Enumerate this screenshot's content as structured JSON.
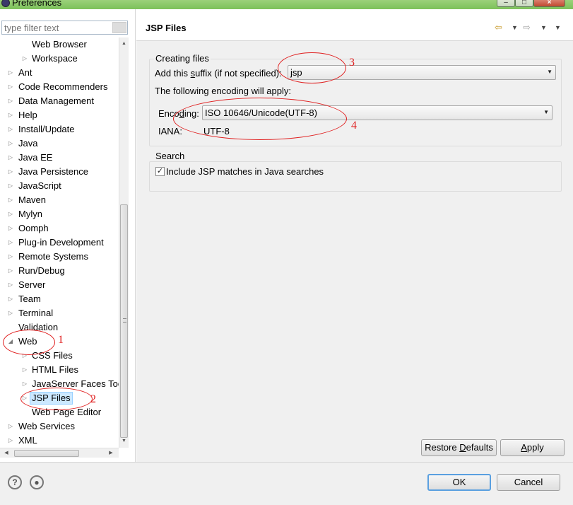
{
  "window": {
    "title": "Preferences"
  },
  "filter": {
    "placeholder": "type filter text"
  },
  "tree": {
    "items": [
      {
        "label": "Web Browser",
        "depth": 2,
        "toggle": "none"
      },
      {
        "label": "Workspace",
        "depth": 2,
        "toggle": "collapsed"
      },
      {
        "label": "Ant",
        "depth": 1,
        "toggle": "collapsed"
      },
      {
        "label": "Code Recommenders",
        "depth": 1,
        "toggle": "collapsed"
      },
      {
        "label": "Data Management",
        "depth": 1,
        "toggle": "collapsed"
      },
      {
        "label": "Help",
        "depth": 1,
        "toggle": "collapsed"
      },
      {
        "label": "Install/Update",
        "depth": 1,
        "toggle": "collapsed"
      },
      {
        "label": "Java",
        "depth": 1,
        "toggle": "collapsed"
      },
      {
        "label": "Java EE",
        "depth": 1,
        "toggle": "collapsed"
      },
      {
        "label": "Java Persistence",
        "depth": 1,
        "toggle": "collapsed"
      },
      {
        "label": "JavaScript",
        "depth": 1,
        "toggle": "collapsed"
      },
      {
        "label": "Maven",
        "depth": 1,
        "toggle": "collapsed"
      },
      {
        "label": "Mylyn",
        "depth": 1,
        "toggle": "collapsed"
      },
      {
        "label": "Oomph",
        "depth": 1,
        "toggle": "collapsed"
      },
      {
        "label": "Plug-in Development",
        "depth": 1,
        "toggle": "collapsed"
      },
      {
        "label": "Remote Systems",
        "depth": 1,
        "toggle": "collapsed"
      },
      {
        "label": "Run/Debug",
        "depth": 1,
        "toggle": "collapsed"
      },
      {
        "label": "Server",
        "depth": 1,
        "toggle": "collapsed"
      },
      {
        "label": "Team",
        "depth": 1,
        "toggle": "collapsed"
      },
      {
        "label": "Terminal",
        "depth": 1,
        "toggle": "collapsed"
      },
      {
        "label": "Validation",
        "depth": 1,
        "toggle": "none"
      },
      {
        "label": "Web",
        "depth": 1,
        "toggle": "expanded"
      },
      {
        "label": "CSS Files",
        "depth": 2,
        "toggle": "collapsed"
      },
      {
        "label": "HTML Files",
        "depth": 2,
        "toggle": "collapsed"
      },
      {
        "label": "JavaServer Faces Too",
        "depth": 2,
        "toggle": "collapsed"
      },
      {
        "label": "JSP Files",
        "depth": 2,
        "toggle": "collapsed",
        "selected": true
      },
      {
        "label": "Web Page Editor",
        "depth": 2,
        "toggle": "none"
      },
      {
        "label": "Web Services",
        "depth": 1,
        "toggle": "collapsed"
      },
      {
        "label": "XML",
        "depth": 1,
        "toggle": "collapsed"
      }
    ]
  },
  "page": {
    "title": "JSP Files",
    "icons": {
      "back": "back-arrow-icon",
      "forward": "forward-arrow-icon",
      "menu": "view-menu-icon"
    },
    "creating": {
      "group_label": "Creating files",
      "suffix_label_pre": "Add this ",
      "suffix_label_mnemonic": "s",
      "suffix_label_post": "uffix (if not specified):",
      "suffix_value": "jsp",
      "encoding_intro": "The following encoding will apply:",
      "encoding_label_pre": "Enco",
      "encoding_label_mnemonic": "d",
      "encoding_label_post": "ing:",
      "encoding_value": "ISO 10646/Unicode(UTF-8)",
      "iana_label": "IANA:",
      "iana_value": "UTF-8"
    },
    "search": {
      "group_label": "Search",
      "include_label": "Include JSP matches in Java searches",
      "include_checked": true
    },
    "restore_pre": "Restore ",
    "restore_mnemonic": "D",
    "restore_post": "efaults",
    "apply_mnemonic": "A",
    "apply_post": "pply"
  },
  "footer": {
    "help_icon": "help-icon",
    "import_icon": "import-export-icon",
    "ok_label": "OK",
    "cancel_label": "Cancel"
  },
  "annotations": [
    "1",
    "2",
    "3",
    "4"
  ],
  "annotation_color": "#e02020"
}
